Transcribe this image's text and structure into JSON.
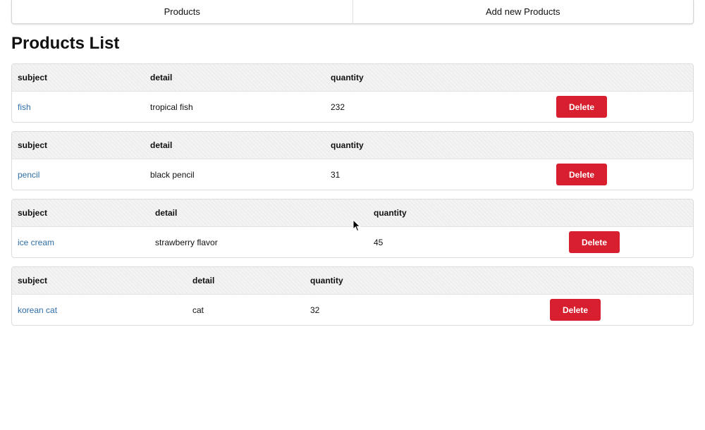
{
  "nav": {
    "tabs": [
      {
        "label": "Products"
      },
      {
        "label": "Add new Products"
      }
    ]
  },
  "page": {
    "title": "Products List"
  },
  "table": {
    "headers": {
      "subject": "subject",
      "detail": "detail",
      "quantity": "quantity"
    },
    "delete_label": "Delete"
  },
  "products": [
    {
      "subject": "fish",
      "detail": "tropical fish",
      "quantity": "232"
    },
    {
      "subject": "pencil",
      "detail": "black pencil",
      "quantity": "31"
    },
    {
      "subject": "ice cream",
      "detail": "strawberry flavor",
      "quantity": "45"
    },
    {
      "subject": "korean cat",
      "detail": "cat",
      "quantity": "32"
    }
  ]
}
